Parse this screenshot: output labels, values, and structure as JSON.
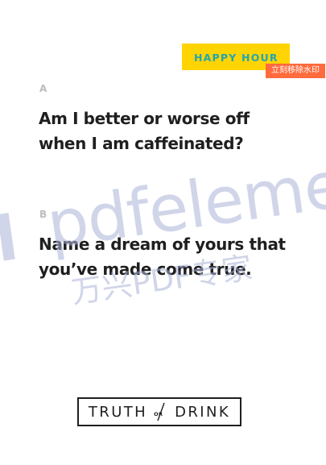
{
  "badge": {
    "label": "HAPPY HOUR"
  },
  "watermark_button": {
    "label": "立刻移除水印"
  },
  "questions": [
    {
      "letter": "A",
      "text": "Am I better or worse off when I am caffeinated?"
    },
    {
      "letter": "B",
      "text": "Name a dream of yours that you’ve made come true."
    }
  ],
  "watermark": {
    "text_main": "pdfeleme",
    "text_sub": "万兴PDF专家"
  },
  "brand": {
    "word_left": "TRUTH",
    "word_or": "OR",
    "word_right": "DRINK"
  }
}
